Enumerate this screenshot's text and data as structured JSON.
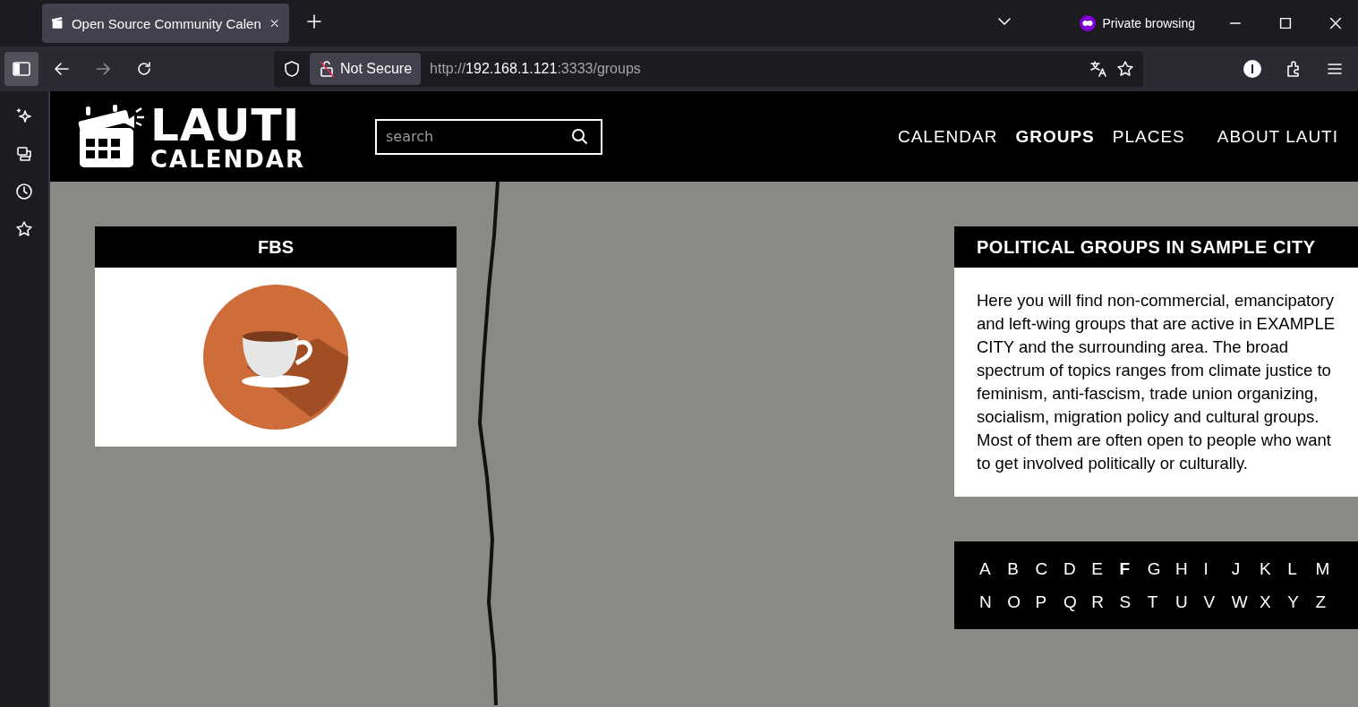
{
  "browser": {
    "tab_title": "Open Source Community Calen",
    "private_label": "Private browsing",
    "security_label": "Not Secure",
    "url_prefix": "http://",
    "url_host": "192.168.1.121",
    "url_rest": ":3333/groups"
  },
  "site": {
    "logo_title": "LAUTI",
    "logo_subtitle": "CALENDAR",
    "search": {
      "placeholder": "search"
    },
    "nav": [
      {
        "label": "CALENDAR",
        "selected": false
      },
      {
        "label": "GROUPS",
        "selected": true
      },
      {
        "label": "PLACES",
        "selected": false
      },
      {
        "label": "ABOUT LAUTI",
        "selected": false
      }
    ]
  },
  "groups": [
    {
      "name": "FBS"
    }
  ],
  "info": {
    "title": "POLITICAL GROUPS IN SAMPLE CITY",
    "text": "Here you will find non-commercial, emancipatory and left-wing groups that are active in EXAMPLE CITY and the surrounding area. The broad spectrum of topics ranges from climate justice to feminism, anti-fascism, trade union organizing, socialism, migration policy and cultural groups. Most of them are often open to people who want to get involved politically or culturally."
  },
  "letters": [
    {
      "label": "A",
      "active": false
    },
    {
      "label": "B",
      "active": false
    },
    {
      "label": "C",
      "active": false
    },
    {
      "label": "D",
      "active": false
    },
    {
      "label": "E",
      "active": false
    },
    {
      "label": "F",
      "active": true
    },
    {
      "label": "G",
      "active": false
    },
    {
      "label": "H",
      "active": false
    },
    {
      "label": "I",
      "active": false
    },
    {
      "label": "J",
      "active": false
    },
    {
      "label": "K",
      "active": false
    },
    {
      "label": "L",
      "active": false
    },
    {
      "label": "M",
      "active": false
    },
    {
      "label": "N",
      "active": false
    },
    {
      "label": "O",
      "active": false
    },
    {
      "label": "P",
      "active": false
    },
    {
      "label": "Q",
      "active": false
    },
    {
      "label": "R",
      "active": false
    },
    {
      "label": "S",
      "active": false
    },
    {
      "label": "T",
      "active": false
    },
    {
      "label": "U",
      "active": false
    },
    {
      "label": "V",
      "active": false
    },
    {
      "label": "W",
      "active": false
    },
    {
      "label": "X",
      "active": false
    },
    {
      "label": "Y",
      "active": false
    },
    {
      "label": "Z",
      "active": false
    }
  ]
}
